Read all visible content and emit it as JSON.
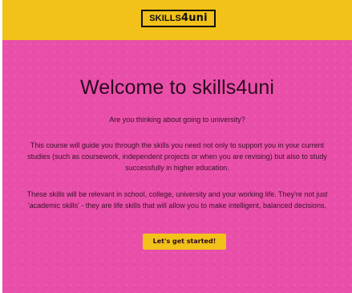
{
  "header": {
    "logo_part1": "SKILLS",
    "logo_part2": "4uni"
  },
  "hero": {
    "title": "Welcome to skills4uni",
    "subtitle": "Are you thinking about going to university?",
    "paragraph_1": "This course will guide you through the skills you need not only to support you in your current studies (such as coursework, independent projects or when you are revising) but also to study successfully in higher education.",
    "paragraph_2": "These skills will be relevant in school, college, university and your working life. They're not just 'academic skills' - they are life skills that will allow you to make intelligent, balanced decisions.",
    "cta_label": "Let's get started!"
  },
  "colors": {
    "header_bg": "#f2c21a",
    "hero_bg": "#e94fa9",
    "button_bg": "#f2c21a",
    "text_dark": "#2b0a1f"
  }
}
